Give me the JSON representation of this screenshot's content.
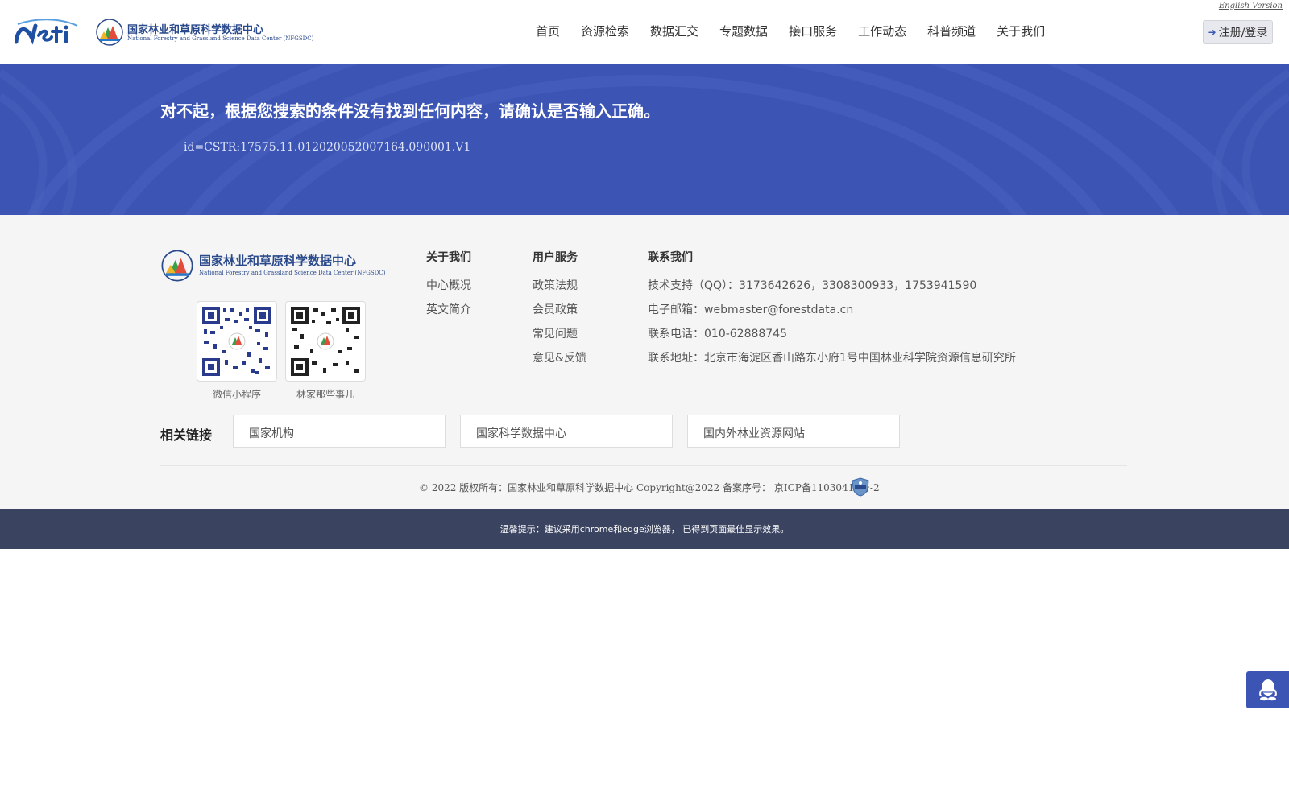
{
  "header": {
    "english_version": "English Version",
    "nsti_logo_text": "Nsti",
    "site_name_cn": "国家林业和草原科学数据中心",
    "site_name_en": "National Forestry and Grassland Science Data Center (NFGSDC)",
    "nav": [
      "首页",
      "资源检索",
      "数据汇交",
      "专题数据",
      "接口服务",
      "工作动态",
      "科普频道",
      "关于我们"
    ],
    "login_label": "注册/登录"
  },
  "banner": {
    "message": "对不起，根据您搜索的条件没有找到任何内容，请确认是否输入正确。",
    "query_id": "id=CSTR:17575.11.012020052007164.090001.V1"
  },
  "footer": {
    "logo_cn": "国家林业和草原科学数据中心",
    "logo_en": "National Forestry and Grassland Science Data Center (NFGSDC)",
    "qr_codes": [
      {
        "label": "微信小程序"
      },
      {
        "label": "林家那些事儿"
      }
    ],
    "about": {
      "title": "关于我们",
      "items": [
        "中心概况",
        "英文简介"
      ]
    },
    "user_service": {
      "title": "用户服务",
      "items": [
        "政策法规",
        "会员政策",
        "常见问题",
        "意见&反馈"
      ]
    },
    "contact": {
      "title": "联系我们",
      "tech_support": "技术支持（QQ）：3173642626，3308300933，1753941590",
      "email": "电子邮箱：webmaster@forestdata.cn",
      "phone": "联系电话：010-62888745",
      "address": "联系地址：北京市海淀区香山路东小府1号中国林业科学院资源信息研究所"
    },
    "related_links_label": "相关链接",
    "related_links": [
      "国家机构",
      "国家科学数据中心",
      "国内外林业资源网站"
    ],
    "copyright": "© 2022 版权所有：国家林业和草原科学数据中心 Copyright@2022    备案序号： 京ICP备11030415号-2"
  },
  "tipbar": {
    "text": "温馨提示：建议采用chrome和edge浏览器， 已得到页面最佳显示效果。"
  },
  "colors": {
    "banner_bg": "#3c55b5",
    "tipbar_bg": "#3a4360",
    "brand_blue": "#2a4a8c"
  }
}
